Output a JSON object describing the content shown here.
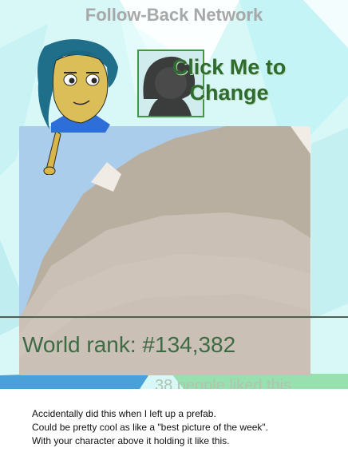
{
  "game": {
    "title": "Follow-Back Network",
    "avatar_button_label": "Click Me to Change",
    "world_rank": "World rank: #134,382",
    "likes_text": "38 people liked this"
  },
  "caption": {
    "lines": [
      "Accidentally did this when I left up a prefab.",
      "Could be pretty cool as like a \"best picture of the week\".",
      "With your character above it holding it like this."
    ]
  },
  "colors": {
    "title": "#a8a8a8",
    "accent_green": "#3f9a3f",
    "rank_text": "#3d6b45"
  },
  "icons": {
    "character": "cartoon-character",
    "avatar": "silhouette-avatar-icon"
  }
}
